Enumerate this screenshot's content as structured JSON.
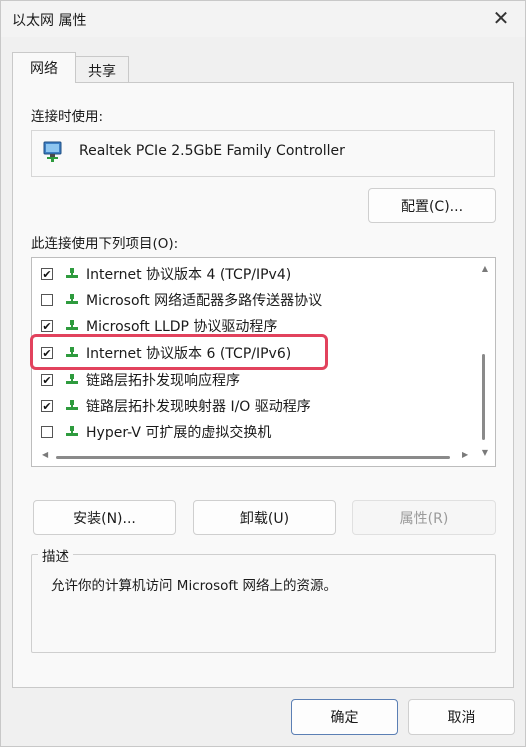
{
  "window": {
    "title": "以太网 属性",
    "close_icon": "✕"
  },
  "tabs": [
    {
      "label": "网络",
      "active": true
    },
    {
      "label": "共享",
      "active": false
    }
  ],
  "connect_using_label": "连接时使用:",
  "adapter": {
    "name": "Realtek PCIe 2.5GbE Family Controller",
    "icon": "network-adapter-icon"
  },
  "configure_button": "配置(C)...",
  "items_label": "此连接使用下列项目(O):",
  "items": [
    {
      "label": "Internet 协议版本 4 (TCP/IPv4)",
      "checked": true
    },
    {
      "label": "Microsoft 网络适配器多路传送器协议",
      "checked": false
    },
    {
      "label": "Microsoft LLDP 协议驱动程序",
      "checked": true
    },
    {
      "label": "Internet 协议版本 6 (TCP/IPv6)",
      "checked": true
    },
    {
      "label": "链路层拓扑发现响应程序",
      "checked": true
    },
    {
      "label": "链路层拓扑发现映射器 I/O 驱动程序",
      "checked": true
    },
    {
      "label": "Hyper-V 可扩展的虚拟交换机",
      "checked": false
    }
  ],
  "buttons": {
    "install": "安装(N)...",
    "uninstall": "卸载(U)",
    "properties": "属性(R)"
  },
  "description": {
    "legend": "描述",
    "text": "允许你的计算机访问 Microsoft 网络上的资源。"
  },
  "footer": {
    "ok": "确定",
    "cancel": "取消"
  },
  "colors": {
    "highlight": "#e2425d",
    "network_icon": "#2e9b3e"
  }
}
